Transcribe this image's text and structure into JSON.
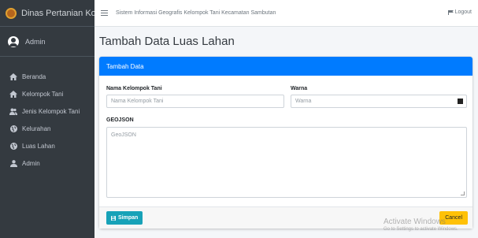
{
  "sidebar": {
    "brand": "Dinas Pertanian Kota Sa",
    "user": "Admin",
    "items": [
      {
        "label": "Beranda",
        "icon": "home-icon"
      },
      {
        "label": "Kelompok Tani",
        "icon": "home-icon"
      },
      {
        "label": "Jenis Kelompok Tani",
        "icon": "users-icon"
      },
      {
        "label": "Kelurahan",
        "icon": "globe-icon"
      },
      {
        "label": "Luas Lahan",
        "icon": "globe-icon"
      },
      {
        "label": "Admin",
        "icon": "user-icon"
      }
    ]
  },
  "topbar": {
    "title": "Sistem Informasi Geografis Kelompok Tani Kecamatan Sambutan",
    "logout": "Logout"
  },
  "page": {
    "title": "Tambah Data Luas Lahan"
  },
  "form": {
    "header": "Tambah Data",
    "nama_label": "Nama Kelompok Tani",
    "nama_placeholder": "Nama Kelompok Tani",
    "warna_label": "Warna",
    "warna_placeholder": "Warna",
    "geojson_label": "GEOJSON",
    "geojson_placeholder": "GeoJSON",
    "save_label": "Simpan",
    "cancel_label": "Cancel"
  },
  "watermark": {
    "title": "Activate Windows",
    "subtitle": "Go to Settings to activate Windows."
  },
  "colors": {
    "sidebar_bg": "#343a40",
    "primary": "#007bff",
    "info": "#17a2b8",
    "warning": "#ffc107"
  }
}
